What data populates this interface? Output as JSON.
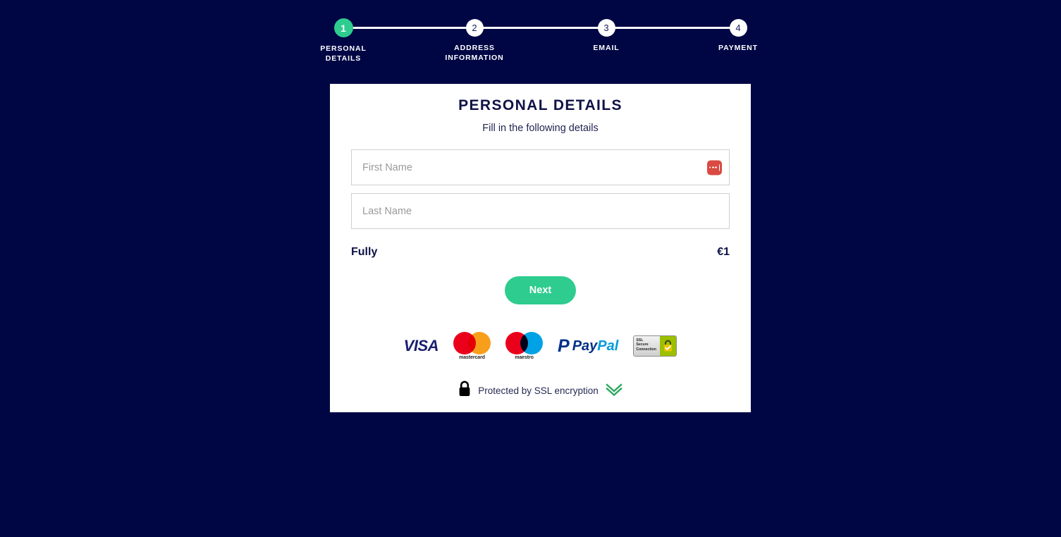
{
  "theme": {
    "background": "#000644",
    "card_background": "#ffffff",
    "accent_green": "#2ecc8f",
    "navy_text": "#0f1147",
    "autofill_red": "#d94b41"
  },
  "stepper": {
    "steps": [
      {
        "number": "1",
        "label": "PERSONAL\nDETAILS",
        "state": "active"
      },
      {
        "number": "2",
        "label": "ADDRESS\nINFORMATION",
        "state": "inactive"
      },
      {
        "number": "3",
        "label": "EMAIL",
        "state": "inactive"
      },
      {
        "number": "4",
        "label": "PAYMENT",
        "state": "inactive"
      }
    ]
  },
  "card": {
    "title": "PERSONAL DETAILS",
    "subtitle": "Fill in the following details",
    "fields": [
      {
        "name": "first-name",
        "placeholder": "First Name",
        "value": "",
        "has_autofill_icon": true
      },
      {
        "name": "last-name",
        "placeholder": "Last Name",
        "value": "",
        "has_autofill_icon": false
      }
    ],
    "summary": {
      "label": "Fully",
      "price": "€1"
    },
    "next_button": "Next"
  },
  "payment_logos": [
    {
      "name": "visa",
      "text": "VISA"
    },
    {
      "name": "mastercard",
      "text": "mastercard"
    },
    {
      "name": "maestro",
      "text": "maestro"
    },
    {
      "name": "paypal",
      "text_pay": "Pay",
      "text_pal": "Pal",
      "mark": "P"
    },
    {
      "name": "ssl-secure-connection",
      "text": "SSL\nSecure\nConnection"
    }
  ],
  "ssl_footer": {
    "text": "Protected by SSL encryption"
  }
}
